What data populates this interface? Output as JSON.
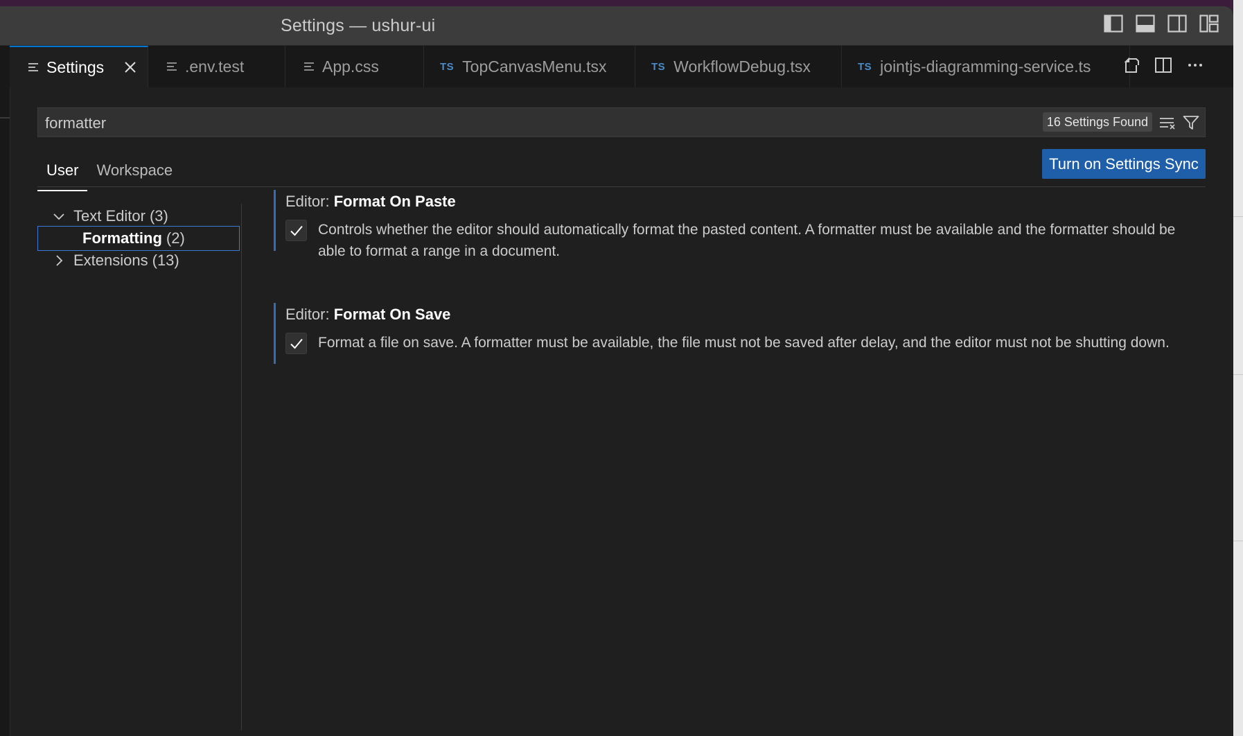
{
  "window": {
    "title": "Settings — ushur-ui"
  },
  "tabs": [
    {
      "label": "Settings",
      "icon": "settings-lines-icon",
      "active": true
    },
    {
      "label": ".env.test",
      "icon": "file-lines-icon"
    },
    {
      "label": "App.css",
      "icon": "file-lines-icon"
    },
    {
      "label": "TopCanvasMenu.tsx",
      "badge": "TS"
    },
    {
      "label": "WorkflowDebug.tsx",
      "badge": "TS"
    },
    {
      "label": "jointjs-diagramming-service.ts",
      "badge": "TS"
    }
  ],
  "search": {
    "value": "formatter",
    "results_label": "16 Settings Found"
  },
  "scope_tabs": [
    "User",
    "Workspace"
  ],
  "sync_button": "Turn on Settings Sync",
  "toc": [
    {
      "label": "Text Editor",
      "count": "(3)",
      "expanded": true
    },
    {
      "label": "Formatting",
      "count": "(2)",
      "selected": true
    },
    {
      "label": "Extensions",
      "count": "(13)",
      "expanded": false
    }
  ],
  "settings": [
    {
      "category": "Editor: ",
      "name": "Format On Paste",
      "checked": true,
      "description": "Controls whether the editor should automatically format the pasted content. A formatter must be available and the formatter should be able to format a range in a document."
    },
    {
      "category": "Editor: ",
      "name": "Format On Save",
      "checked": true,
      "description": "Format a file on save. A formatter must be available, the file must not be saved after delay, and the editor must not be shutting down."
    }
  ],
  "colors": {
    "accent": "#0078d4",
    "sync_button": "#1f5ea8",
    "ts_badge": "#4a8bc9",
    "background": "#1f1f1f"
  }
}
